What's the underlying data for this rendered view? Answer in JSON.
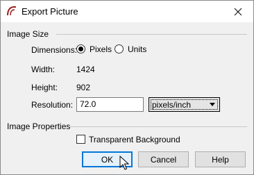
{
  "window": {
    "title": "Export Picture"
  },
  "image_size": {
    "section_label": "Image Size",
    "dimensions_label": "Dimensions:",
    "radio_pixels": "Pixels",
    "radio_units": "Units",
    "selected": "Pixels",
    "width_label": "Width:",
    "width_value": "1424",
    "height_label": "Height:",
    "height_value": "902",
    "resolution_label": "Resolution:",
    "resolution_value": "72.0",
    "resolution_unit": "pixels/inch"
  },
  "image_properties": {
    "section_label": "Image Properties",
    "transparent_label": "Transparent Background",
    "transparent_checked": false
  },
  "buttons": {
    "ok": "OK",
    "cancel": "Cancel",
    "help": "Help"
  },
  "icons": {
    "app": "app-logo-icon",
    "close": "close-icon",
    "cursor": "mouse-pointer-icon"
  }
}
